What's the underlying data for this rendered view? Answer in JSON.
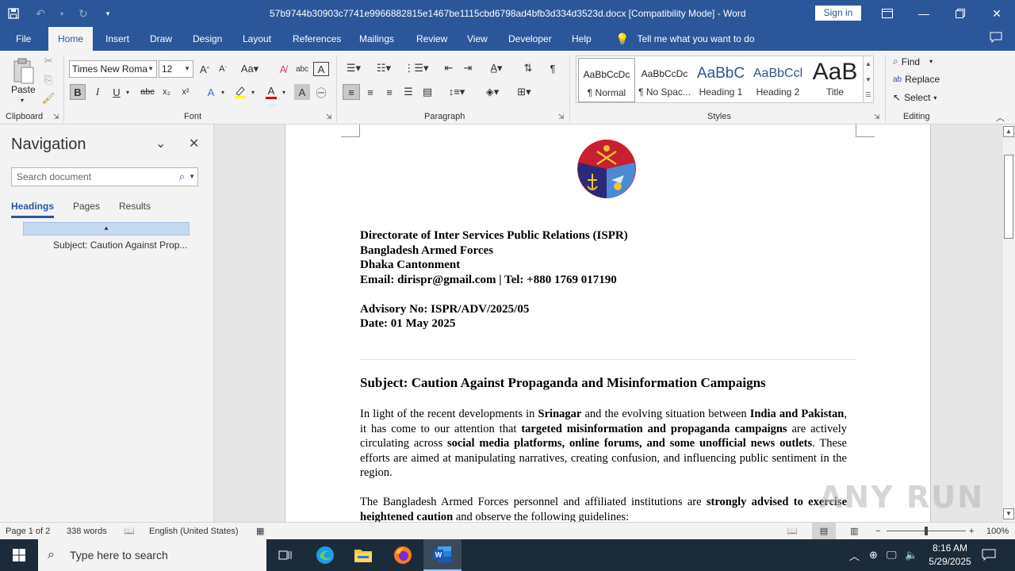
{
  "titlebar": {
    "doc_title": "57b9744b30903c7741e9966882815e1467be1115cbd6798ad4bfb3d334d3523d.docx [Compatibility Mode] - Word",
    "sign_in": "Sign in"
  },
  "tabs": [
    "File",
    "Home",
    "Insert",
    "Draw",
    "Design",
    "Layout",
    "References",
    "Mailings",
    "Review",
    "View",
    "Developer",
    "Help"
  ],
  "tellme": "Tell me what you want to do",
  "ribbon": {
    "clipboard": {
      "label": "Clipboard",
      "paste": "Paste"
    },
    "font": {
      "label": "Font",
      "font_name": "Times New Roma",
      "font_size": "12"
    },
    "paragraph": {
      "label": "Paragraph"
    },
    "styles": {
      "label": "Styles",
      "items": [
        {
          "preview": "AaBbCcDc",
          "name": "¶ Normal"
        },
        {
          "preview": "AaBbCcDc",
          "name": "¶ No Spac..."
        },
        {
          "preview": "AaBbC",
          "name": "Heading 1"
        },
        {
          "preview": "AaBbCcl",
          "name": "Heading 2"
        },
        {
          "preview": "AaB",
          "name": "Title"
        }
      ]
    },
    "editing": {
      "label": "Editing",
      "find": "Find",
      "replace": "Replace",
      "select": "Select"
    }
  },
  "navigation": {
    "title": "Navigation",
    "search_placeholder": "Search document",
    "tabs": [
      "Headings",
      "Pages",
      "Results"
    ],
    "heading_item": "Subject: Caution Against Prop..."
  },
  "document": {
    "header_lines": [
      "Directorate of Inter Services Public Relations (ISPR)",
      "Bangladesh Armed Forces",
      "Dhaka Cantonment",
      "Email: dirispr@gmail.com  | Tel: +880 1769 017190"
    ],
    "advisory_no": "Advisory No: ISPR/ADV/2025/05",
    "date": "Date: 01 May 2025",
    "subject": "Subject: Caution Against Propaganda and Misinformation Campaigns",
    "para1": {
      "t1": "In light of the recent developments in ",
      "b1": "Srinagar",
      "t2": " and the evolving situation between ",
      "b2": "India and Pakistan",
      "t3": ", it has come to our attention that ",
      "b3": "targeted misinformation and propaganda campaigns",
      "t4": " are actively circulating across ",
      "b4": "social media platforms, online forums, and some unofficial news outlets",
      "t5": ". These efforts are aimed at manipulating narratives, creating confusion, and influencing public sentiment in the region."
    },
    "para2": {
      "t1": "The Bangladesh Armed Forces personnel and affiliated institutions are ",
      "b1": "strongly advised to exercise heightened caution",
      "t2": " and observe the following guidelines:"
    }
  },
  "watermark": "ANY RUN",
  "statusbar": {
    "page": "Page 1 of 2",
    "words": "338 words",
    "language": "English (United States)",
    "zoom": "100%"
  },
  "taskbar": {
    "search_placeholder": "Type here to search",
    "time": "8:16 AM",
    "date": "5/29/2025"
  }
}
